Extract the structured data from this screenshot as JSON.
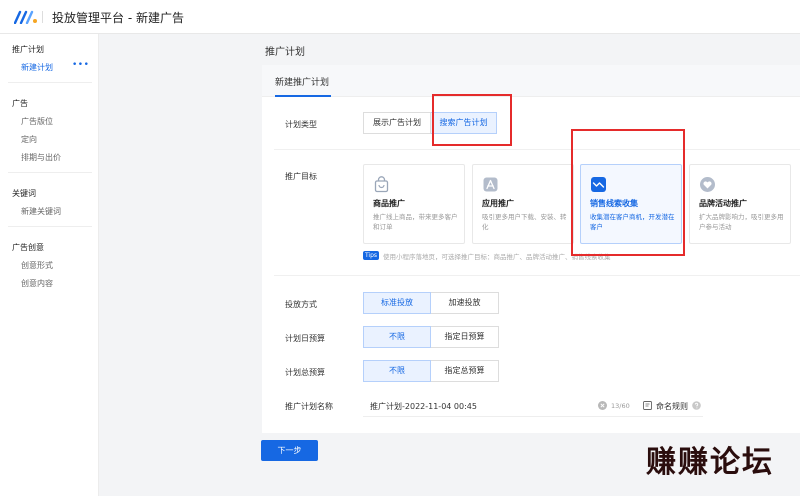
{
  "app": {
    "title": "投放管理平台 - 新建广告",
    "brand_color": "#1668e3"
  },
  "sidebar": {
    "groups": [
      {
        "title": "推广计划",
        "items": [
          "新建计划"
        ]
      },
      {
        "title": "广告",
        "items": [
          "广告版位",
          "定向",
          "排期与出价"
        ]
      },
      {
        "title": "关键词",
        "items": [
          "新建关键词"
        ]
      },
      {
        "title": "广告创意",
        "items": [
          "创意形式",
          "创意内容"
        ]
      }
    ],
    "more_icon": "ellipsis-icon"
  },
  "page": {
    "title": "推广计划",
    "tab": "新建推广计划"
  },
  "form": {
    "plan_type": {
      "label": "计划类型",
      "options": [
        "展示广告计划",
        "搜索广告计划"
      ],
      "selected": "搜索广告计划"
    },
    "goal": {
      "label": "推广目标",
      "cards": [
        {
          "title": "商品推广",
          "desc": "推广线上商品，带来更多客户和订单",
          "icon": "shopping-bag-icon"
        },
        {
          "title": "应用推广",
          "desc": "吸引更多用户下载、安装、转化",
          "icon": "app-icon"
        },
        {
          "title": "销售线索收集",
          "desc": "收集潜在客户商机，开发潜在客户",
          "icon": "lead-icon"
        },
        {
          "title": "品牌活动推广",
          "desc": "扩大品牌影响力，吸引更多用户参与活动",
          "icon": "heart-icon"
        }
      ],
      "selected": "销售线索收集",
      "tips_badge": "Tips",
      "tips_text": "使用小程序落地页，可选择推广目标：商品推广、品牌活动推广、销售线索收集"
    },
    "delivery": {
      "label": "投放方式",
      "options": [
        "标准投放",
        "加速投放"
      ],
      "selected": "标准投放"
    },
    "daily_budget": {
      "label": "计划日预算",
      "options": [
        "不限",
        "指定日预算"
      ],
      "selected": "不限"
    },
    "total_budget": {
      "label": "计划总预算",
      "options": [
        "不限",
        "指定总预算"
      ],
      "selected": "不限"
    },
    "plan_name": {
      "label": "推广计划名称",
      "value": "推广计划-2022-11-04 00:45",
      "counter": "13/60",
      "naming_rule": "命名规则"
    }
  },
  "actions": {
    "next": "下一步"
  },
  "watermark": "赚赚论坛",
  "annotation_color": "#e52b2b"
}
